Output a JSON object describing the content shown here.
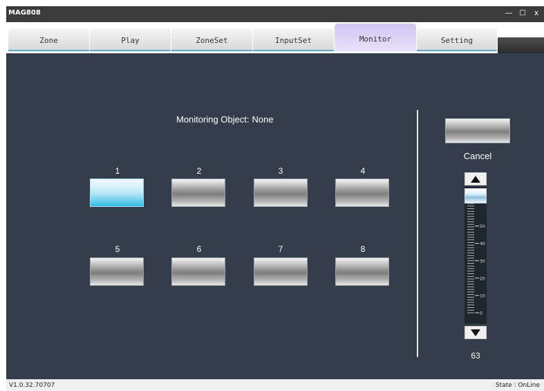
{
  "window": {
    "title": "MAG808",
    "minimize_glyph": "—",
    "maximize_glyph": "□",
    "close_glyph": "x"
  },
  "tabs": [
    {
      "label": "Zone",
      "active": false
    },
    {
      "label": "Play",
      "active": false
    },
    {
      "label": "ZoneSet",
      "active": false
    },
    {
      "label": "InputSet",
      "active": false
    },
    {
      "label": "Monitor",
      "active": true
    },
    {
      "label": "Setting",
      "active": false
    }
  ],
  "monitor": {
    "object_label": "Monitoring Object:",
    "object_value": "None",
    "selected_channel": "1",
    "channels": [
      {
        "label": "1"
      },
      {
        "label": "2"
      },
      {
        "label": "3"
      },
      {
        "label": "4"
      },
      {
        "label": "5"
      },
      {
        "label": "6"
      },
      {
        "label": "7"
      },
      {
        "label": "8"
      }
    ]
  },
  "volume": {
    "cancel_label": "Cancel",
    "value": "63",
    "level": 63,
    "scale_min": 0,
    "scale_max": 63,
    "scale_labels": [
      "50",
      "40",
      "30",
      "20",
      "10",
      "0"
    ],
    "up_icon": "triangle-up-icon",
    "down_icon": "triangle-down-icon"
  },
  "status": {
    "version": "V1.0.32.70707",
    "state": "State : OnLine"
  },
  "colors": {
    "panel_bg": "#333e4a",
    "selected_channel": "#33bde4",
    "active_tab": "#cfc6f2",
    "titlebar": "#3b3b3b"
  }
}
